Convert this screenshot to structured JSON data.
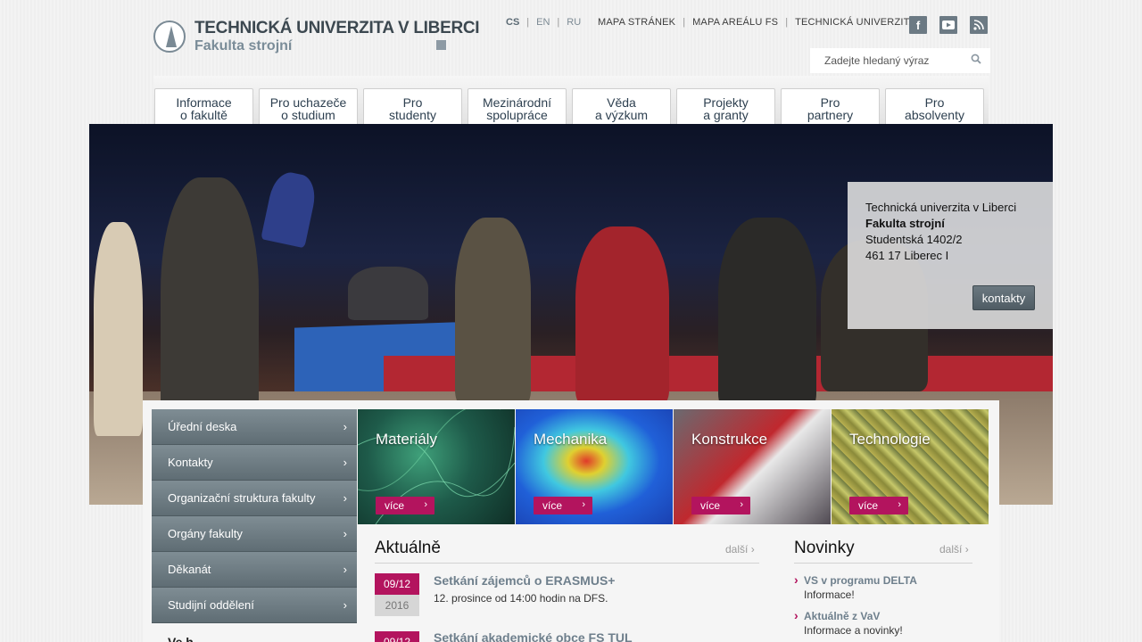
{
  "header": {
    "logo_line1": "TECHNICKÁ UNIVERZITA V LIBERCI",
    "logo_line2": "Fakulta strojní",
    "languages": [
      "CS",
      "EN",
      "RU"
    ],
    "links": [
      "MAPA STRÁNEK",
      "MAPA AREÁLU FS",
      "TECHNICKÁ UNIVERZITA"
    ],
    "social": [
      "facebook-icon",
      "youtube-icon",
      "rss-icon"
    ],
    "search_placeholder": "Zadejte hledaný výraz"
  },
  "menu": [
    {
      "line1": "Informace",
      "line2": "o fakultě"
    },
    {
      "line1": "Pro uchazeče",
      "line2": "o studium"
    },
    {
      "line1": "Pro",
      "line2": "studenty"
    },
    {
      "line1": "Mezinárodní",
      "line2": "spolupráce"
    },
    {
      "line1": "Věda",
      "line2": "a výzkum"
    },
    {
      "line1": "Projekty",
      "line2": "a granty"
    },
    {
      "line1": "Pro",
      "line2": "partnery"
    },
    {
      "line1": "Pro",
      "line2": "absolventy"
    }
  ],
  "contact_box": {
    "line1": "Technická univerzita v Liberci",
    "line2": "Fakulta strojní",
    "line3": "Studentská 1402/2",
    "line4": "461 17 Liberec I",
    "button": "kontakty"
  },
  "sidenav": [
    "Úřední deska",
    "Kontakty",
    "Organizační struktura fakulty",
    "Orgány fakulty",
    "Děkanát",
    "Studijní oddělení"
  ],
  "sidenav_more": "Ve h",
  "tiles": [
    {
      "title": "Materiály",
      "button": "více",
      "color": "#1e5b4a"
    },
    {
      "title": "Mechanika",
      "button": "více",
      "color": "#1f5fc8"
    },
    {
      "title": "Konstrukce",
      "button": "více",
      "color": "#7a3a3a"
    },
    {
      "title": "Technologie",
      "button": "více",
      "color": "#8f8a3a"
    }
  ],
  "news": {
    "title": "Aktuálně",
    "more": "další",
    "items": [
      {
        "day_month": "09/12",
        "year": "2016",
        "title": "Setkání zájemců o ERASMUS+",
        "subtitle": "12. prosince od 14:00 hodin na DFS."
      },
      {
        "day_month": "09/12",
        "year": "",
        "title": "Setkání akademické obce FS TUL",
        "subtitle": ""
      }
    ]
  },
  "novinky": {
    "title": "Novinky",
    "more": "další",
    "items": [
      {
        "title": "VS v programu DELTA",
        "subtitle": "Informace!"
      },
      {
        "title": "Aktuálně z VaV",
        "subtitle": "Informace a novinky!"
      }
    ]
  }
}
